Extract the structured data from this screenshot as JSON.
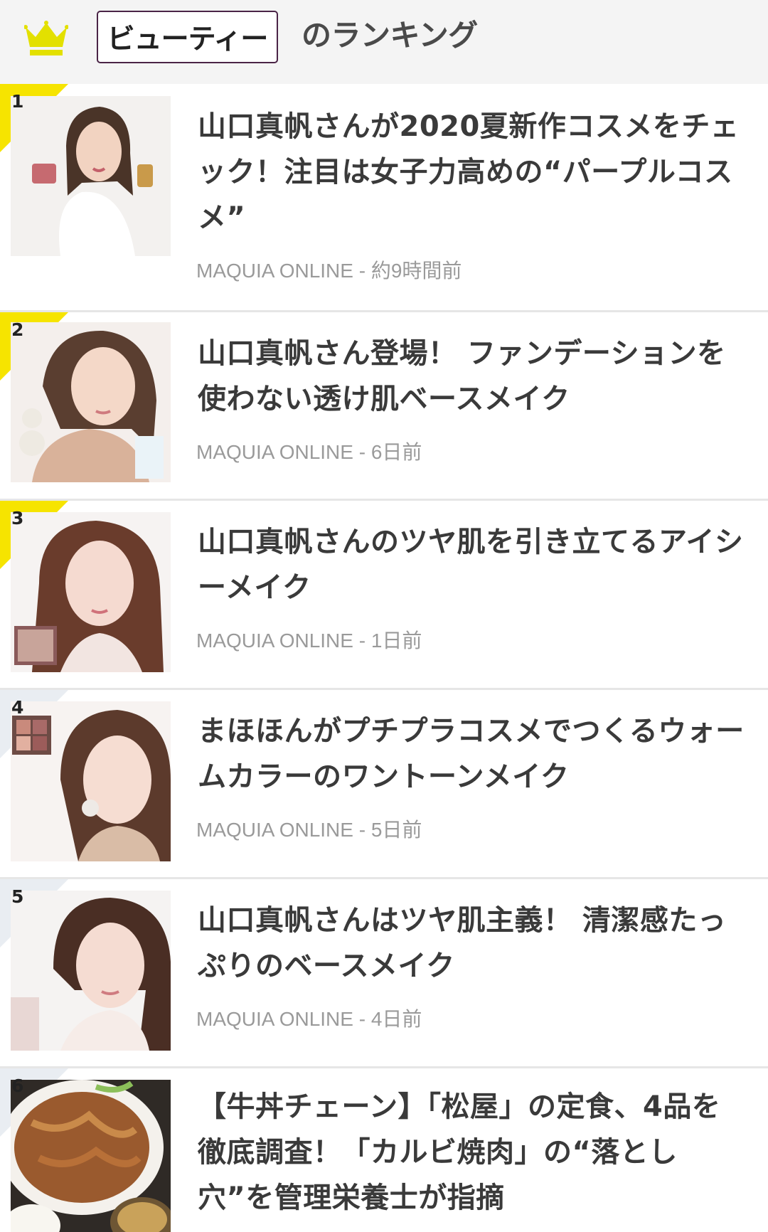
{
  "header": {
    "category": "ビューティー",
    "ranking_label": "のランキング",
    "crown_icon": "crown-icon",
    "crown_color": "#e3e000",
    "box_border_color": "#4a2446"
  },
  "colors": {
    "top_ribbon": "#f6e400",
    "other_ribbon": "#e9edf2",
    "meta": "#9a9a9a"
  },
  "items": [
    {
      "rank": "1",
      "title": "山口真帆さんが2020夏新作コスメをチェック！注目は女子力高めの“パープルコスメ”",
      "meta": "MAQUIA ONLINE - 約9時間前"
    },
    {
      "rank": "2",
      "title": "山口真帆さん登場！ ファンデーションを使わない透け肌ベースメイク",
      "meta": "MAQUIA ONLINE - 6日前"
    },
    {
      "rank": "3",
      "title": "山口真帆さんのツヤ肌を引き立てるアイシーメイク",
      "meta": "MAQUIA ONLINE - 1日前"
    },
    {
      "rank": "4",
      "title": "まほほんがプチプラコスメでつくるウォームカラーのワントーンメイク",
      "meta": "MAQUIA ONLINE - 5日前"
    },
    {
      "rank": "5",
      "title": "山口真帆さんはツヤ肌主義！ 清潔感たっぷりのベースメイク",
      "meta": "MAQUIA ONLINE - 4日前"
    },
    {
      "rank": "6",
      "title": "【牛丼チェーン】「松屋」の定食、4品を徹底調査！「カルビ焼肉」の“落とし穴”を管理栄養士が指摘",
      "meta": ""
    }
  ]
}
